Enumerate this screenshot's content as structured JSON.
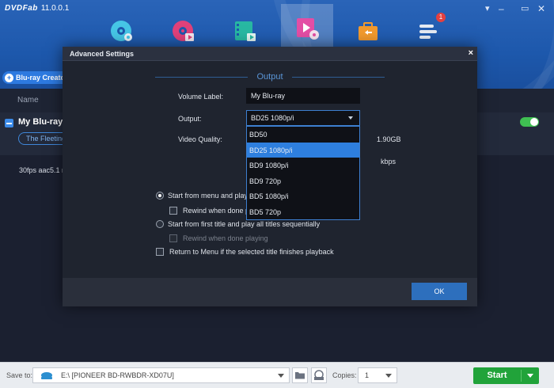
{
  "app": {
    "brand": "DVDFab",
    "version": "11.0.0.1",
    "creator_button": "Blu-ray Creator",
    "badge_count": "1"
  },
  "list": {
    "col_name": "Name",
    "title": "My Blu-ray",
    "pill": "The Fleeting",
    "audio": "30fps aac5.1 n"
  },
  "bottom": {
    "save_to_label": "Save to:",
    "save_path": "E:\\ [PIONEER BD-RWBDR-XD07U]",
    "copies_label": "Copies:",
    "copies_value": "1",
    "start_label": "Start"
  },
  "dialog": {
    "title": "Advanced Settings",
    "close": "×",
    "output_section": "Output",
    "playback_section_partial": "P",
    "volume_label_label": "Volume Label:",
    "volume_label_value": "My Blu-ray",
    "output_label": "Output:",
    "output_value": "BD25 1080p/i",
    "video_quality_label": "Video Quality:",
    "size_value": "1.90GB",
    "bitrate_unit": "kbps",
    "output_options": [
      {
        "label": "BD50",
        "selected": false
      },
      {
        "label": "BD25 1080p/i",
        "selected": true
      },
      {
        "label": "BD9 1080p/i",
        "selected": false
      },
      {
        "label": "BD9 720p",
        "selected": false
      },
      {
        "label": "BD5 1080p/i",
        "selected": false
      },
      {
        "label": "BD5 720p",
        "selected": false
      }
    ],
    "playback": {
      "start_menu": "Start from menu and play a",
      "rewind_1": "Rewind when done p",
      "start_first": "Start from first title and play all titles sequentially",
      "rewind_2": "Rewind when done playing",
      "return_menu": "Return to Menu if the selected title finishes playback"
    },
    "ok_label": "OK"
  },
  "colors": {
    "accent": "#2e7fde",
    "start_green": "#21a33a",
    "header_blue": "#1d58ac"
  }
}
